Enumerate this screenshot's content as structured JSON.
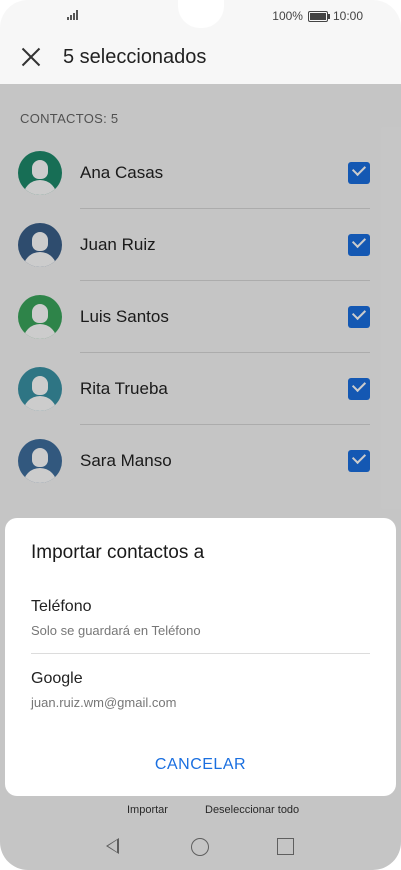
{
  "status_bar": {
    "battery_percent": "100%",
    "time": "10:00"
  },
  "app_bar": {
    "title": "5 seleccionados"
  },
  "section_label": "CONTACTOS: 5",
  "contacts": [
    {
      "name": "Ana Casas",
      "avatar_color": "#1d8a6b",
      "checked": true
    },
    {
      "name": "Juan Ruiz",
      "avatar_color": "#3a5f8a",
      "checked": true
    },
    {
      "name": "Luis Santos",
      "avatar_color": "#3aa55c",
      "checked": true
    },
    {
      "name": "Rita Trueba",
      "avatar_color": "#3a93a6",
      "checked": true
    },
    {
      "name": "Sara Manso",
      "avatar_color": "#3f6f9e",
      "checked": true
    }
  ],
  "bottom_bar": {
    "import_label": "Importar",
    "deselect_label": "Deseleccionar todo"
  },
  "dialog": {
    "title": "Importar contactos a",
    "options": [
      {
        "title": "Teléfono",
        "subtitle": "Solo se guardará en Teléfono"
      },
      {
        "title": "Google",
        "subtitle": "juan.ruiz.wm@gmail.com"
      }
    ],
    "cancel_label": "CANCELAR"
  },
  "colors": {
    "accent": "#1a6fe0",
    "scrim": "rgba(0,0,0,0.2)"
  }
}
